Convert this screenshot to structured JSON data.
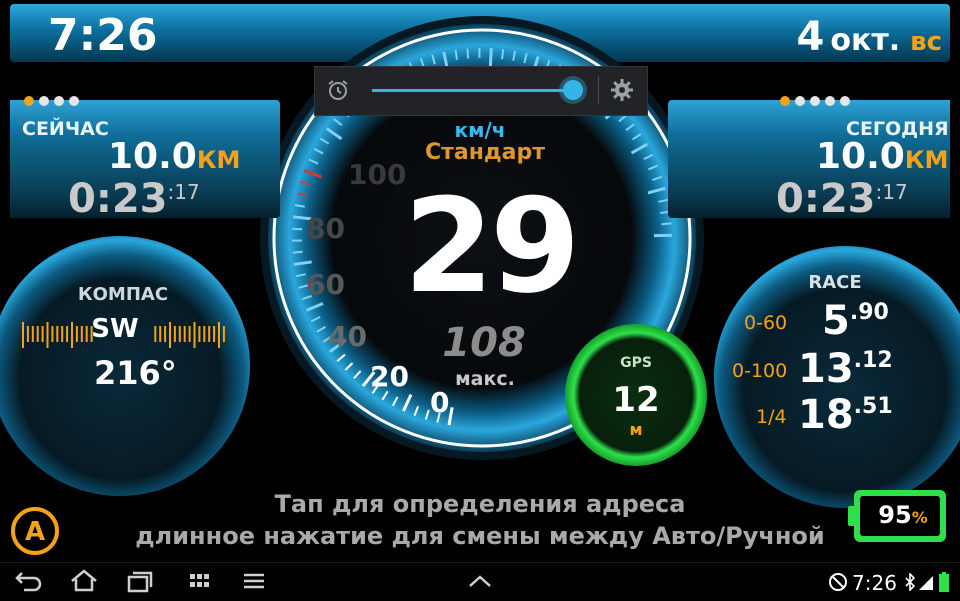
{
  "header": {
    "time": "7:26",
    "date_day": "4",
    "date_month": "окт.",
    "date_weekday": "вс"
  },
  "now_panel": {
    "label": "СЕЙЧАС",
    "distance": "10.0",
    "distance_unit": "КМ",
    "time": "0:23",
    "time_seconds": ":17",
    "page_dots": 4,
    "active_dot": 1
  },
  "today_panel": {
    "label": "СЕГОДНЯ",
    "distance": "10.0",
    "distance_unit": "КМ",
    "time": "0:23",
    "time_seconds": ":17",
    "page_dots": 5,
    "active_dot": 1
  },
  "compass": {
    "label": "КОМПАС",
    "direction": "SW",
    "degrees": "216°"
  },
  "speedometer": {
    "unit": "км/ч",
    "mode": "Стандарт",
    "speed": "29",
    "max_value": "108",
    "max_label": "макс.",
    "scale_labels": [
      "0",
      "20",
      "40",
      "60",
      "80",
      "100"
    ]
  },
  "gps": {
    "label": "GPS",
    "value": "12",
    "unit": "м"
  },
  "race": {
    "title": "RACE",
    "rows": [
      {
        "label": "0-60",
        "value": "5",
        "decimal": ".90"
      },
      {
        "label": "0-100",
        "value": "13",
        "decimal": ".12"
      },
      {
        "label": "1/4",
        "value": "18",
        "decimal": ".51"
      }
    ]
  },
  "address_hint": {
    "line1": "Тап для определения адреса",
    "line2": "длинное нажатие для смены между Авто/Ручной"
  },
  "auto_button": {
    "label": "A"
  },
  "battery": {
    "value": "95",
    "unit": "%"
  },
  "brightness_popup": {
    "level": 0.98,
    "icons": [
      "alarm-icon",
      "gear-icon"
    ]
  },
  "nav_bar": {
    "time": "7:26",
    "icons": [
      "back-icon",
      "home-icon",
      "recent-apps-icon",
      "apps-grid-icon",
      "menu-icon",
      "chevron-up-icon",
      "no-sim-icon",
      "bluetooth-icon",
      "signal-icon",
      "battery-icon"
    ]
  },
  "colors": {
    "accent_blue": "#2aa7dd",
    "accent_orange": "#f5a21a",
    "gps_green": "#2ee04a",
    "speed_red": "#d33b2a"
  }
}
